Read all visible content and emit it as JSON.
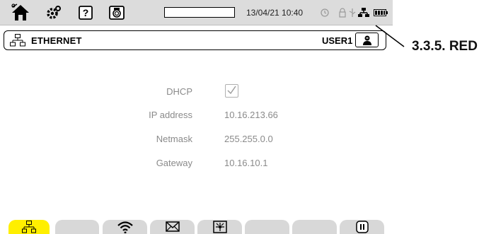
{
  "status_bar": {
    "datetime": "13/04/21 10:40",
    "icons": [
      "home-icon",
      "settings-icon",
      "help-icon",
      "camera-icon",
      "progress-bar",
      "alarm-icon",
      "usb-icon",
      "network-icon",
      "battery-icon"
    ]
  },
  "header": {
    "title": "ETHERNET",
    "user": "USER1"
  },
  "form": {
    "dhcp": {
      "label": "DHCP",
      "checked": true
    },
    "ip": {
      "label": "IP address",
      "value": "10.16.213.66"
    },
    "netmask": {
      "label": "Netmask",
      "value": "255.255.0.0"
    },
    "gateway": {
      "label": "Gateway",
      "value": "10.16.10.1"
    }
  },
  "tabs": [
    {
      "icon": "network-icon",
      "active": true
    },
    {
      "icon": "",
      "active": false
    },
    {
      "icon": "wifi-icon",
      "active": false
    },
    {
      "icon": "envelope-icon",
      "active": false
    },
    {
      "icon": "server-icon",
      "active": false
    },
    {
      "icon": "",
      "active": false
    },
    {
      "icon": "",
      "active": false
    },
    {
      "icon": "pause-icon",
      "active": false
    }
  ],
  "callout": {
    "text": "3.3.5. RED"
  },
  "colors": {
    "active_tab": "#ffef00",
    "tab": "#d8d8d8",
    "status_bar": "#dcdcdc",
    "muted_text": "#8a8a8a"
  }
}
